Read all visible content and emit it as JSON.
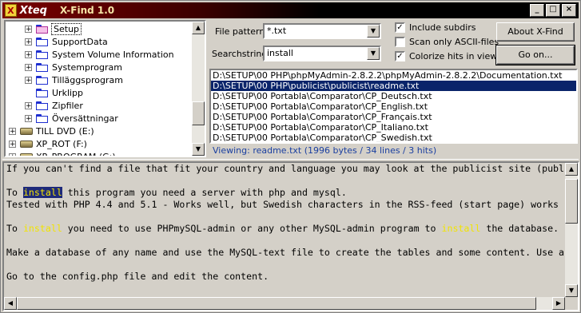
{
  "window": {
    "brand": "Xteq",
    "title": "X-Find 1.0",
    "buttons": [
      "_",
      "□",
      "×"
    ]
  },
  "tree": {
    "items": [
      {
        "label": "Setup",
        "type": "folder-pink",
        "selected": true
      },
      {
        "label": "SupportData",
        "type": "folder"
      },
      {
        "label": "System Volume Information",
        "type": "folder"
      },
      {
        "label": "Systemprogram",
        "type": "folder"
      },
      {
        "label": "Tilläggsprogram",
        "type": "folder"
      },
      {
        "label": "Urklipp",
        "type": "folder"
      },
      {
        "label": "Zipfiler",
        "type": "folder"
      },
      {
        "label": "Översättningar",
        "type": "folder"
      },
      {
        "label": "TILL DVD (E:)",
        "type": "drive"
      },
      {
        "label": "XP_ROT (F:)",
        "type": "drive"
      },
      {
        "label": "XP_PROGRAM (G:)",
        "type": "drive"
      }
    ]
  },
  "search": {
    "file_pattern_label": "File pattern",
    "file_pattern_value": "*.txt",
    "searchstring_label": "Searchstring",
    "searchstring_value": "install"
  },
  "options": {
    "include_subdirs": {
      "label": "Include subdirs",
      "checked": true
    },
    "ascii_only": {
      "label": "Scan only ASCII-files",
      "checked": false
    },
    "colorize": {
      "label": "Colorize hits in viewer",
      "checked": true
    }
  },
  "buttons": {
    "about": "About X-Find",
    "go": "Go on..."
  },
  "results": [
    "D:\\SETUP\\00 PHP\\phpMyAdmin-2.8.2.2\\phpMyAdmin-2.8.2.2\\Documentation.txt",
    "D:\\SETUP\\00 PHP\\publicist\\publicist\\readme.txt",
    "D:\\SETUP\\00 Portabla\\Comparator\\CP_Deutsch.txt",
    "D:\\SETUP\\00 Portabla\\Comparator\\CP_English.txt",
    "D:\\SETUP\\00 Portabla\\Comparator\\CP_Français.txt",
    "D:\\SETUP\\00 Portabla\\Comparator\\CP_Italiano.txt",
    "D:\\SETUP\\00 Portabla\\Comparator\\CP_Swedish.txt"
  ],
  "selected_result": 1,
  "status": "Viewing: readme.txt (1996 bytes / 34 lines / 3 hits)",
  "viewer": {
    "lines": [
      [
        {
          "t": "If you can't find a file that fit your country and language you may look at the publicist site (publ"
        }
      ],
      [
        {
          "t": ""
        }
      ],
      [
        {
          "t": "To "
        },
        {
          "t": "install",
          "h": "sel"
        },
        {
          "t": " this program you need a server with php and mysql."
        }
      ],
      [
        {
          "t": "Tested with PHP 4.4 and 5.1 - Works well, but Swedish characters in the RSS-feed (start page) works"
        }
      ],
      [
        {
          "t": ""
        }
      ],
      [
        {
          "t": "To "
        },
        {
          "t": "install",
          "h": "hit"
        },
        {
          "t": " you need to use PHPmySQL-admin or any other MySQL-admin program to "
        },
        {
          "t": "install",
          "h": "hit"
        },
        {
          "t": " the database."
        }
      ],
      [
        {
          "t": ""
        }
      ],
      [
        {
          "t": "Make a database of any name and use the MySQL-text file to create the tables and some content. Use a"
        }
      ],
      [
        {
          "t": ""
        }
      ],
      [
        {
          "t": "Go to the config.php file and edit the content."
        }
      ]
    ]
  },
  "colors": {
    "title_gradient_start": "#7a0000",
    "selection": "#0a246a",
    "status_text": "#1a3fa0",
    "hit_highlight": "#f2e400"
  }
}
